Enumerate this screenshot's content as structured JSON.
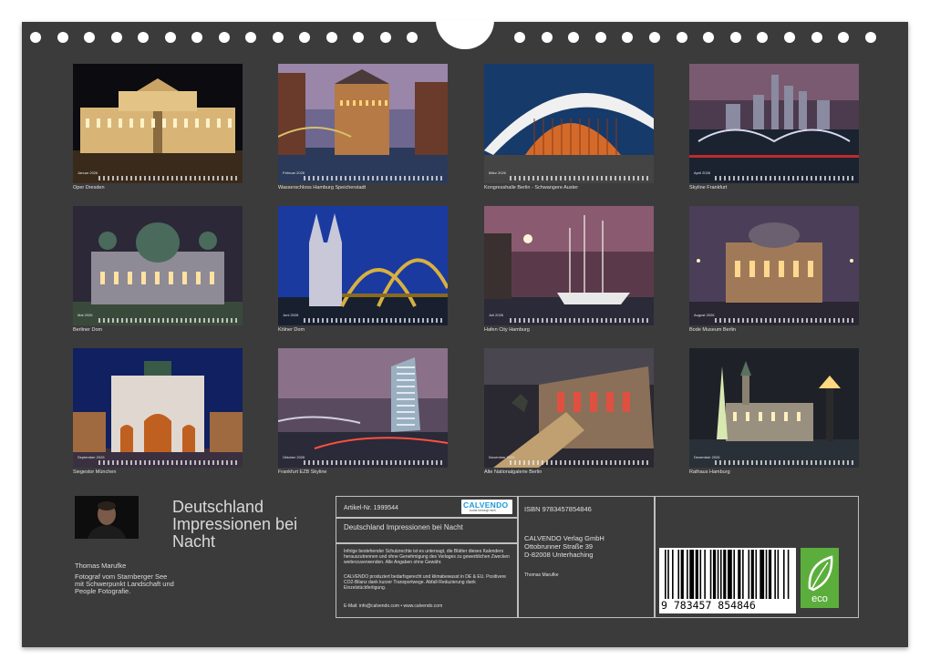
{
  "calendar": {
    "tiles": [
      {
        "month": "Januar 2026",
        "caption": "Oper Dresden"
      },
      {
        "month": "Februar 2026",
        "caption": "Wasserschloss Hamburg Speicherstadt"
      },
      {
        "month": "März 2026",
        "caption": "Kongresshalle Berlin - Schwangere Auster"
      },
      {
        "month": "April 2026",
        "caption": "Skyline Frankfurt"
      },
      {
        "month": "Mai 2026",
        "caption": "Berliner Dom"
      },
      {
        "month": "Juni 2026",
        "caption": "Kölner Dom"
      },
      {
        "month": "Juli 2026",
        "caption": "Hafen City Hamburg"
      },
      {
        "month": "August 2026",
        "caption": "Bode Museum Berlin"
      },
      {
        "month": "September 2026",
        "caption": "Siegestor München"
      },
      {
        "month": "Oktober 2026",
        "caption": "Frankfurt EZB Skyline"
      },
      {
        "month": "November 2026",
        "caption": "Alte Nationalgalerie Berlin"
      },
      {
        "month": "Dezember 2026",
        "caption": "Rathaus Hamburg"
      }
    ]
  },
  "product": {
    "title_lines": [
      "Deutschland",
      "Impressionen bei",
      "Nacht"
    ],
    "author_name": "Thomas Marufke",
    "author_bio": "Fotograf vom Starnberger See mit Schwerpunkt Landschaft und People Fotografie.",
    "article_number": "Artikel-Nr. 1999544",
    "isbn": "ISBN 9783457854846",
    "box_title": "Deutschland Impressionen bei Nacht",
    "legal_text": "Infolge bestehender Schutzrechte ist es untersagt, die Blätter dieses Kalenders herauszutrennen und ohne Genehmigung des Verlages zu gewerblichen Zwecken weiterzuverwenden. Alle Angaben ohne Gewähr.",
    "eco_text": "CALVENDO produziert bedarfsgerecht und klimabewusst in DE & EU. Positivere CO2-Bilanz dank kurzer Transportwege. Abfall-Reduzierung dank Einzelstückfertigung.",
    "email_line": "E-Mail: info@calvendo.com • www.calvendo.com",
    "publisher_lines": [
      "CALVENDO Verlag GmbH",
      "Ottobrunner Straße 39",
      "D-82008 Unterhaching"
    ],
    "photographer_small": "Thomas Marufke",
    "logo_name": "CALVENDO",
    "logo_sub": "kunst bewegt mich",
    "barcode_digits": "9 783457 854846",
    "eco_label": "eco"
  },
  "colors": {
    "board": "#3b3b3c",
    "eco_green": "#5cae3c",
    "calvendo_blue": "#1a9ad6"
  }
}
